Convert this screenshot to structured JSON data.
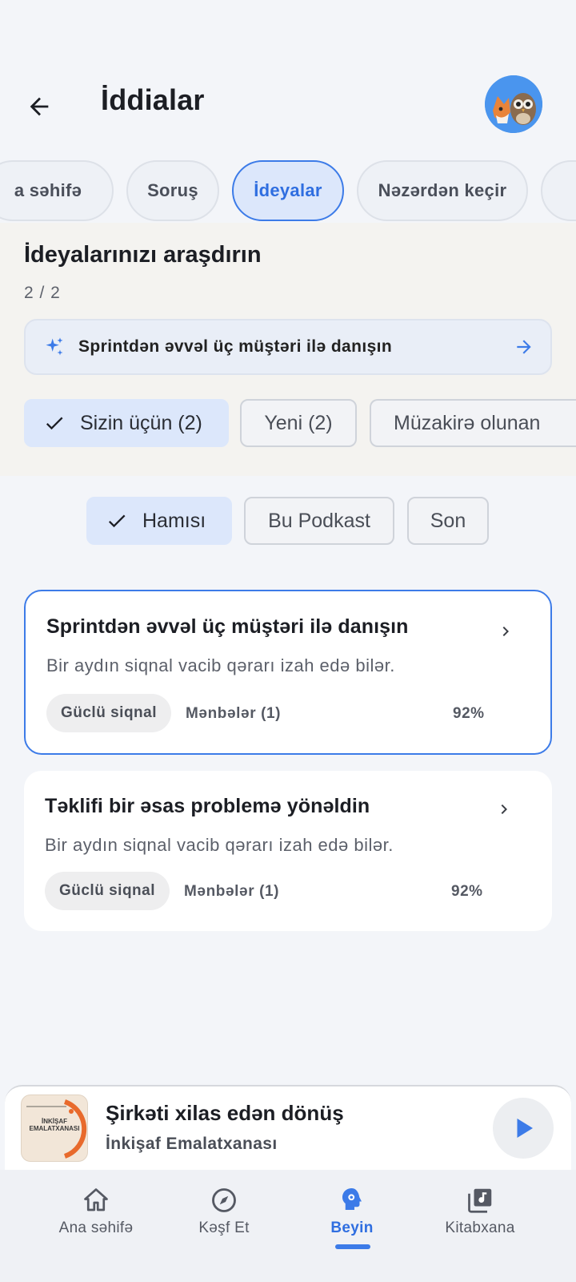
{
  "header": {
    "title": "İddialar",
    "back_icon": "arrow-left-icon",
    "avatar_icon": "fox-and-owl-avatar"
  },
  "tabs": [
    {
      "label": "a səhifə",
      "active": false
    },
    {
      "label": "Soruş",
      "active": false
    },
    {
      "label": "İdeyalar",
      "active": true
    },
    {
      "label": "Nəzərdən keçir",
      "active": false
    },
    {
      "label": "",
      "active": false
    }
  ],
  "explore": {
    "title": "İdeyalarınızı araşdırın",
    "count": "2 / 2",
    "suggestion": "Sprintdən əvvəl üç müştəri ilə danışın",
    "filters": [
      {
        "label": "Sizin üçün (2)",
        "selected": true
      },
      {
        "label": "Yeni (2)",
        "selected": false
      },
      {
        "label": "Müzakirə olunan",
        "selected": false
      }
    ]
  },
  "scope_filters": [
    {
      "label": "Hamısı",
      "selected": true
    },
    {
      "label": "Bu Podkast",
      "selected": false
    },
    {
      "label": "Son",
      "selected": false
    }
  ],
  "cards": [
    {
      "title": "Sprintdən əvvəl üç müştəri ilə danışın",
      "description": "Bir aydın siqnal vacib qərarı izah edə bilər.",
      "badge": "Güclü siqnal",
      "sources": "Mənbələr (1)",
      "percent": "92%",
      "selected": true
    },
    {
      "title": "Təklifi bir əsas problemə yönəldin",
      "description": "Bir aydın siqnal vacib qərarı izah edə bilər.",
      "badge": "Güclü siqnal",
      "sources": "Mənbələr (1)",
      "percent": "92%",
      "selected": false
    }
  ],
  "player": {
    "title": "Şirkəti xilas edən dönüş",
    "subtitle": "İnkişaf Emalatxanası",
    "cover_text": "İNKİŞAF EMALATXANASI"
  },
  "bottom_nav": [
    {
      "label": "Ana səhifə",
      "icon": "home-icon",
      "active": false
    },
    {
      "label": "Kəşf Et",
      "icon": "compass-icon",
      "active": false
    },
    {
      "label": "Beyin",
      "icon": "brain-icon",
      "active": true
    },
    {
      "label": "Kitabxana",
      "icon": "library-music-icon",
      "active": false
    }
  ],
  "colors": {
    "accent": "#3c7be8",
    "background": "#f3f5f9",
    "chip_selected": "#dce7fb"
  }
}
